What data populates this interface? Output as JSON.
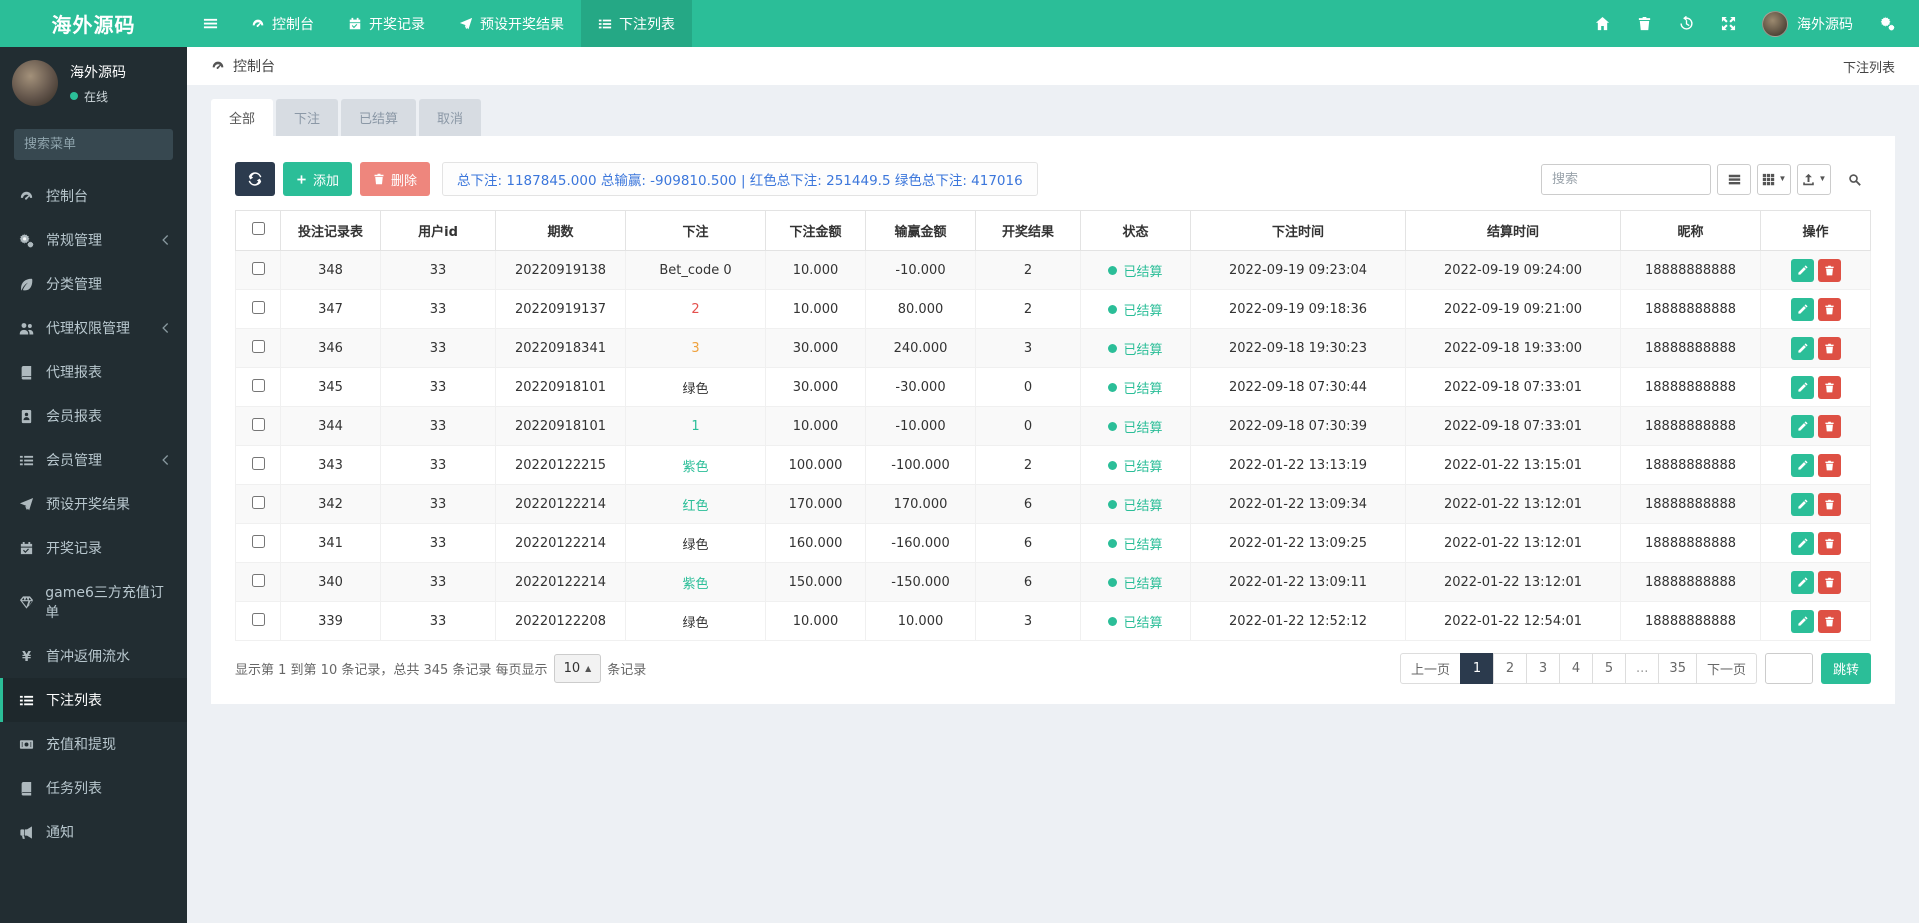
{
  "navbar": {
    "brand": "海外源码",
    "items": [
      {
        "name": "dashboard",
        "icon": "gauge",
        "label": "控制台",
        "active": false
      },
      {
        "name": "draw-records",
        "icon": "calendar",
        "label": "开奖记录",
        "active": false
      },
      {
        "name": "preset-results",
        "icon": "send",
        "label": "预设开奖结果",
        "active": false
      },
      {
        "name": "bet-list",
        "icon": "list",
        "label": "下注列表",
        "active": true
      }
    ],
    "right_icons_before": [
      {
        "name": "home-icon",
        "icon": "home"
      },
      {
        "name": "trash-icon",
        "icon": "trash"
      },
      {
        "name": "history-icon",
        "icon": "history"
      },
      {
        "name": "fullscreen-icon",
        "icon": "expand"
      }
    ],
    "user": {
      "name": "海外源码"
    },
    "right_icons_after": [
      {
        "name": "settings-gears-icon",
        "icon": "cogs"
      }
    ]
  },
  "sidebar": {
    "user": {
      "name": "海外源码",
      "status": "在线"
    },
    "search_placeholder": "搜索菜单",
    "items": [
      {
        "name": "sidebar-item-dashboard",
        "icon": "gauge",
        "label": "控制台",
        "active": false,
        "chevron": false
      },
      {
        "name": "sidebar-item-general",
        "icon": "cogs",
        "label": "常规管理",
        "active": false,
        "chevron": true
      },
      {
        "name": "sidebar-item-category",
        "icon": "leaf",
        "label": "分类管理",
        "active": false,
        "chevron": false
      },
      {
        "name": "sidebar-item-agent-perm",
        "icon": "users",
        "label": "代理权限管理",
        "active": false,
        "chevron": true
      },
      {
        "name": "sidebar-item-agent-report",
        "icon": "book",
        "label": "代理报表",
        "active": false,
        "chevron": false
      },
      {
        "name": "sidebar-item-member-report",
        "icon": "idcard",
        "label": "会员报表",
        "active": false,
        "chevron": false
      },
      {
        "name": "sidebar-item-member-mgmt",
        "icon": "list",
        "label": "会员管理",
        "active": false,
        "chevron": true
      },
      {
        "name": "sidebar-item-preset-results",
        "icon": "send",
        "label": "预设开奖结果",
        "active": false,
        "chevron": false
      },
      {
        "name": "sidebar-item-draw-records",
        "icon": "calendar",
        "label": "开奖记录",
        "active": false,
        "chevron": false
      },
      {
        "name": "sidebar-item-game6-orders",
        "icon": "gem",
        "label": "game6三方充值订单",
        "active": false,
        "chevron": false
      },
      {
        "name": "sidebar-item-first-charge",
        "icon": "yen",
        "label": "首冲返佣流水",
        "active": false,
        "chevron": false
      },
      {
        "name": "sidebar-item-bet-list",
        "icon": "list",
        "label": "下注列表",
        "active": true,
        "chevron": false
      },
      {
        "name": "sidebar-item-deposit-withdraw",
        "icon": "money",
        "label": "充值和提现",
        "active": false,
        "chevron": false
      },
      {
        "name": "sidebar-item-task-list",
        "icon": "book",
        "label": "任务列表",
        "active": false,
        "chevron": false
      },
      {
        "name": "sidebar-item-notice",
        "icon": "bullhorn",
        "label": "通知",
        "active": false,
        "chevron": false
      }
    ]
  },
  "header": {
    "breadcrumb": "控制台",
    "page_title": "下注列表"
  },
  "tabs": [
    {
      "label": "全部",
      "active": true
    },
    {
      "label": "下注",
      "active": false
    },
    {
      "label": "已结算",
      "active": false
    },
    {
      "label": "取消",
      "active": false
    }
  ],
  "toolbar": {
    "add_label": "添加",
    "delete_label": "删除",
    "summary": "总下注: 1187845.000 总输赢: -909810.500 | 红色总下注: 251449.5 绿色总下注: 417016",
    "search_placeholder": "搜索"
  },
  "table": {
    "columns": [
      "投注记录表",
      "用户id",
      "期数",
      "下注",
      "下注金额",
      "输赢金额",
      "开奖结果",
      "状态",
      "下注时间",
      "结算时间",
      "昵称",
      "操作"
    ],
    "rows": [
      {
        "id": "348",
        "user_id": "33",
        "period": "20220919138",
        "bet": "Bet_code 0",
        "bet_color": "default",
        "amount": "10.000",
        "winloss": "-10.000",
        "result": "2",
        "status": "已结算",
        "bet_time": "2022-09-19 09:23:04",
        "settle_time": "2022-09-19 09:24:00",
        "nickname": "18888888888"
      },
      {
        "id": "347",
        "user_id": "33",
        "period": "20220919137",
        "bet": "2",
        "bet_color": "red",
        "amount": "10.000",
        "winloss": "80.000",
        "result": "2",
        "status": "已结算",
        "bet_time": "2022-09-19 09:18:36",
        "settle_time": "2022-09-19 09:21:00",
        "nickname": "18888888888"
      },
      {
        "id": "346",
        "user_id": "33",
        "period": "20220918341",
        "bet": "3",
        "bet_color": "orange",
        "amount": "30.000",
        "winloss": "240.000",
        "result": "3",
        "status": "已结算",
        "bet_time": "2022-09-18 19:30:23",
        "settle_time": "2022-09-18 19:33:00",
        "nickname": "18888888888"
      },
      {
        "id": "345",
        "user_id": "33",
        "period": "20220918101",
        "bet": "绿色",
        "bet_color": "default",
        "amount": "30.000",
        "winloss": "-30.000",
        "result": "0",
        "status": "已结算",
        "bet_time": "2022-09-18 07:30:44",
        "settle_time": "2022-09-18 07:33:01",
        "nickname": "18888888888"
      },
      {
        "id": "344",
        "user_id": "33",
        "period": "20220918101",
        "bet": "1",
        "bet_color": "teal",
        "amount": "10.000",
        "winloss": "-10.000",
        "result": "0",
        "status": "已结算",
        "bet_time": "2022-09-18 07:30:39",
        "settle_time": "2022-09-18 07:33:01",
        "nickname": "18888888888"
      },
      {
        "id": "343",
        "user_id": "33",
        "period": "20220122215",
        "bet": "紫色",
        "bet_color": "teal",
        "amount": "100.000",
        "winloss": "-100.000",
        "result": "2",
        "status": "已结算",
        "bet_time": "2022-01-22 13:13:19",
        "settle_time": "2022-01-22 13:15:01",
        "nickname": "18888888888"
      },
      {
        "id": "342",
        "user_id": "33",
        "period": "20220122214",
        "bet": "红色",
        "bet_color": "teal",
        "amount": "170.000",
        "winloss": "170.000",
        "result": "6",
        "status": "已结算",
        "bet_time": "2022-01-22 13:09:34",
        "settle_time": "2022-01-22 13:12:01",
        "nickname": "18888888888"
      },
      {
        "id": "341",
        "user_id": "33",
        "period": "20220122214",
        "bet": "绿色",
        "bet_color": "default",
        "amount": "160.000",
        "winloss": "-160.000",
        "result": "6",
        "status": "已结算",
        "bet_time": "2022-01-22 13:09:25",
        "settle_time": "2022-01-22 13:12:01",
        "nickname": "18888888888"
      },
      {
        "id": "340",
        "user_id": "33",
        "period": "20220122214",
        "bet": "紫色",
        "bet_color": "teal",
        "amount": "150.000",
        "winloss": "-150.000",
        "result": "6",
        "status": "已结算",
        "bet_time": "2022-01-22 13:09:11",
        "settle_time": "2022-01-22 13:12:01",
        "nickname": "18888888888"
      },
      {
        "id": "339",
        "user_id": "33",
        "period": "20220122208",
        "bet": "绿色",
        "bet_color": "default",
        "amount": "10.000",
        "winloss": "10.000",
        "result": "3",
        "status": "已结算",
        "bet_time": "2022-01-22 12:52:12",
        "settle_time": "2022-01-22 12:54:01",
        "nickname": "18888888888"
      }
    ]
  },
  "pagination": {
    "info_prefix": "显示第 1 到第 10 条记录，总共 345 条记录 每页显示",
    "page_size": "10",
    "info_suffix": "条记录",
    "prev": "上一页",
    "next": "下一页",
    "pages": [
      "1",
      "2",
      "3",
      "4",
      "5",
      "...",
      "35"
    ],
    "active_page": "1",
    "jump_label": "跳转"
  },
  "colors": {
    "accent_teal": "#2bbe98",
    "navy": "#2c3b4e",
    "summary_blue": "#3b76db",
    "delete_salmon": "#ee867d",
    "action_delete_red": "#de5044",
    "bet_red": "#e4504d",
    "bet_orange": "#efa23e",
    "sidebar_dark": "#222d32"
  }
}
